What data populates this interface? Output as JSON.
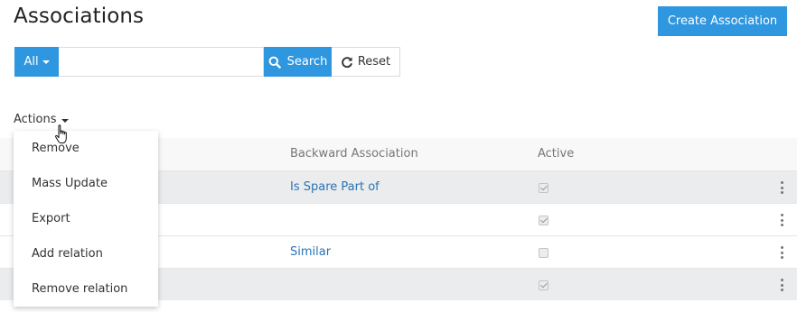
{
  "header": {
    "title": "Associations",
    "create_label": "Create Association"
  },
  "search": {
    "filter_label": "All",
    "input_value": "",
    "search_label": "Search",
    "reset_label": "Reset"
  },
  "actions": {
    "label": "Actions",
    "menu": [
      "Remove",
      "Mass Update",
      "Export",
      "Add relation",
      "Remove relation"
    ]
  },
  "table": {
    "columns": [
      "Backward Association",
      "Active"
    ],
    "rows": [
      {
        "backward": "Is Spare Part of",
        "active": true
      },
      {
        "backward": "",
        "active": true
      },
      {
        "backward": "Similar",
        "active": false
      },
      {
        "backward": "",
        "active": true
      }
    ]
  },
  "colors": {
    "accent": "#2f96e0",
    "link": "#2a73b6",
    "row_alt": "#eaeced"
  },
  "icons": [
    "search-icon",
    "reset-icon",
    "caret-down-icon",
    "kebab-menu-icon",
    "hand-cursor-icon"
  ]
}
